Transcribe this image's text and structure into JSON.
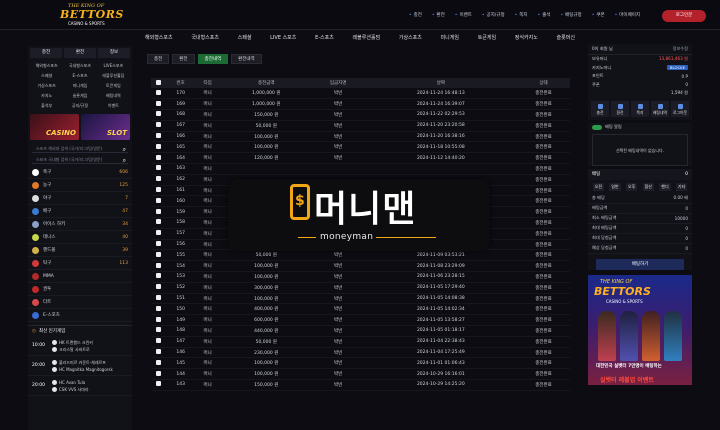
{
  "header": {
    "logo_top": "THE KING OF",
    "logo_main": "BETTORS",
    "logo_sub": "CASINO & SPORTS",
    "nav": [
      "충전",
      "환전",
      "이벤트",
      "공지/규정",
      "쪽지",
      "출석",
      "배팅규정",
      "쿠폰",
      "마이페이지"
    ],
    "login": "로그인문"
  },
  "menu": [
    "해외형스포츠",
    "국내형스포츠",
    "스페셜",
    "LIVE 스포츠",
    "E-스포츠",
    "레볼루션홀덤",
    "가상스포츠",
    "미니게임",
    "토큰게임",
    "정식카지노",
    "슬롯머신"
  ],
  "left": {
    "buttons": [
      "충전",
      "환전",
      "정보"
    ],
    "grid": [
      "해외형스포츠",
      "국내형스포츠",
      "LIVE스포츠",
      "스페셜",
      "E-스포츠",
      "레볼루션홀덤",
      "가상스포츠",
      "미니게임",
      "토큰게임",
      "카지노",
      "슬롯게임",
      "배팅내역",
      "출석부",
      "공지/규정",
      "이벤트"
    ],
    "casino": "CASINO",
    "slot": "SLOT",
    "search1": "스포츠 해외대 검색 (국가/리그/팀/영문)",
    "search2": "스포츠 국내형 검색 (국가/리그/팀/영문)",
    "sports": [
      {
        "name": "축구",
        "count": "606",
        "color": "#ffffff"
      },
      {
        "name": "농구",
        "count": "125",
        "color": "#e07a2a"
      },
      {
        "name": "야구",
        "count": "7",
        "color": "#dddddd"
      },
      {
        "name": "배구",
        "count": "47",
        "color": "#3a7bd5"
      },
      {
        "name": "아이스 하키",
        "count": "34",
        "color": "#8aa0c8"
      },
      {
        "name": "테니스",
        "count": "40",
        "color": "#c6d84a"
      },
      {
        "name": "핸드볼",
        "count": "39",
        "color": "#d4b24a"
      },
      {
        "name": "탁구",
        "count": "113",
        "color": "#d23a3a"
      },
      {
        "name": "MMA",
        "count": "",
        "color": "#b02a2a"
      },
      {
        "name": "권투",
        "count": "",
        "color": "#c22a2a"
      },
      {
        "name": "다트",
        "count": "",
        "color": "#d84a4a"
      },
      {
        "name": "E-스포츠",
        "count": "",
        "color": "#3a6bd5"
      }
    ],
    "live_title": "최신 인기게임",
    "matches": [
      {
        "time": "10:00",
        "team1": "HK 트랜쳅드 크린커",
        "team2": "크리스탈 사바트로"
      },
      {
        "time": "20:00",
        "team1": "블라드미르 카운트-체레르프",
        "team2": "HC Magnitka Magnitogorsk"
      },
      {
        "time": "20:00",
        "team1": "HC Avan Tula",
        "team2": "CSK VVS 사마라"
      }
    ]
  },
  "main": {
    "tabs": [
      "충전",
      "환전",
      "충전내역",
      "환전내역"
    ],
    "active_tab": 2,
    "columns": [
      "",
      "번호",
      "타입",
      "충전금액",
      "입금자명",
      "날짜",
      "상태"
    ],
    "rows": [
      [
        "170",
        "머니",
        "1,000,000 원",
        "박빈",
        "2024-11-24 16:48:13",
        "충전완료"
      ],
      [
        "169",
        "머니",
        "1,000,000 원",
        "박빈",
        "2024-11-24 16:39:07",
        "충전완료"
      ],
      [
        "168",
        "머니",
        "150,000 원",
        "박빈",
        "2024-11-22 02:29:53",
        "충전완료"
      ],
      [
        "167",
        "머니",
        "50,000 원",
        "박빈",
        "2024-11-20 23:20:58",
        "충전완료"
      ],
      [
        "166",
        "머니",
        "100,000 원",
        "박빈",
        "2024-11-20 16:38:16",
        "충전완료"
      ],
      [
        "165",
        "머니",
        "100,000 원",
        "박빈",
        "2024-11-18 10:55:08",
        "충전완료"
      ],
      [
        "164",
        "머니",
        "120,000 원",
        "박빈",
        "2024-11-12 14:40:20",
        "충전완료"
      ],
      [
        "163",
        "머니",
        "",
        "",
        "",
        "충전완료"
      ],
      [
        "162",
        "머니",
        "",
        "",
        "",
        "충전완료"
      ],
      [
        "161",
        "머니",
        "",
        "",
        "",
        "충전완료"
      ],
      [
        "160",
        "머니",
        "",
        "",
        "",
        "충전완료"
      ],
      [
        "159",
        "머니",
        "",
        "",
        "",
        "충전완료"
      ],
      [
        "158",
        "머니",
        "",
        "",
        "",
        "충전완료"
      ],
      [
        "157",
        "머니",
        "300,000 원",
        "박빈",
        "2024-11-10 02:22:17",
        "충전완료"
      ],
      [
        "156",
        "머니",
        "70,000 원",
        "박빈",
        "2024-11-09 11:44:40",
        "충전완료"
      ],
      [
        "155",
        "머니",
        "50,000 원",
        "박빈",
        "2024-11-09 03:53:21",
        "충전완료"
      ],
      [
        "154",
        "머니",
        "100,000 원",
        "박빈",
        "2024-11-08 23:29:09",
        "충전완료"
      ],
      [
        "153",
        "머니",
        "100,000 원",
        "박빈",
        "2024-11-06 23:28:15",
        "충전완료"
      ],
      [
        "152",
        "머니",
        "300,000 원",
        "박빈",
        "2024-11-05 17:29:40",
        "충전완료"
      ],
      [
        "151",
        "머니",
        "100,000 원",
        "박빈",
        "2024-11-05 14:08:38",
        "충전완료"
      ],
      [
        "150",
        "머니",
        "400,000 원",
        "박빈",
        "2024-11-05 14:02:34",
        "충전완료"
      ],
      [
        "149",
        "머니",
        "600,000 원",
        "박빈",
        "2024-11-05 13:58:27",
        "충전완료"
      ],
      [
        "148",
        "머니",
        "440,000 원",
        "박빈",
        "2024-11-05 01:18:17",
        "충전완료"
      ],
      [
        "147",
        "머니",
        "50,000 원",
        "박빈",
        "2024-11-04 22:38:43",
        "충전완료"
      ],
      [
        "146",
        "머니",
        "230,000 원",
        "박빈",
        "2024-11-04 17:25:49",
        "충전완료"
      ],
      [
        "145",
        "머니",
        "100,000 원",
        "박빈",
        "2024-11-01 01:06:43",
        "충전완료"
      ],
      [
        "144",
        "머니",
        "100,000 원",
        "박빈",
        "2024-10-29 16:16:01",
        "충전완료"
      ],
      [
        "143",
        "머니",
        "150,000 원",
        "박빈",
        "2024-10-29 14:25:20",
        "충전완료"
      ]
    ]
  },
  "overlay": {
    "symbol": "$",
    "brand": "머니맨",
    "sub": "moneyman"
  },
  "right": {
    "user": "0의 회원 님",
    "top_link": "정보수정",
    "rows": [
      {
        "label": "보유머니",
        "value": "13,861,463 원"
      },
      {
        "label": "카지노머니",
        "value": "BLOCKE"
      },
      {
        "label": "포인트",
        "value": "0 P"
      },
      {
        "label": "쿠폰",
        "value": "0"
      }
    ],
    "level": "1,594 원",
    "buttons": [
      "충전",
      "환전",
      "쪽지",
      "배팅내역",
      "로그아웃"
    ],
    "toggle": "배팅 알림",
    "message": "선택된 배팅내역이 없습니다.",
    "bet_title": "배팅",
    "bet_count": "0",
    "bet_tabs": [
      "오전",
      "일반",
      "오후",
      "합산",
      "핸디",
      "기타"
    ],
    "bet_rows": [
      {
        "label": "총 배당",
        "value": "0.00 배"
      },
      {
        "label": "배팅금액",
        "value": "0"
      },
      {
        "label": "최소 배팅금액",
        "value": "10000"
      },
      {
        "label": "최대 배팅금액",
        "value": "0"
      },
      {
        "label": "최대 당첨금액",
        "value": "0"
      },
      {
        "label": "예상 당첨금액",
        "value": "0"
      }
    ],
    "bet_button": "배팅하기",
    "banner_top": "THE KING OF",
    "banner_main": "BETTORS",
    "banner_sub": "CASINO & SPORTS",
    "banner_txt1": "대한민국 실벳터 7만명이 배팅하는",
    "banner_txt2": "실벳터 레볼업 이벤트"
  }
}
